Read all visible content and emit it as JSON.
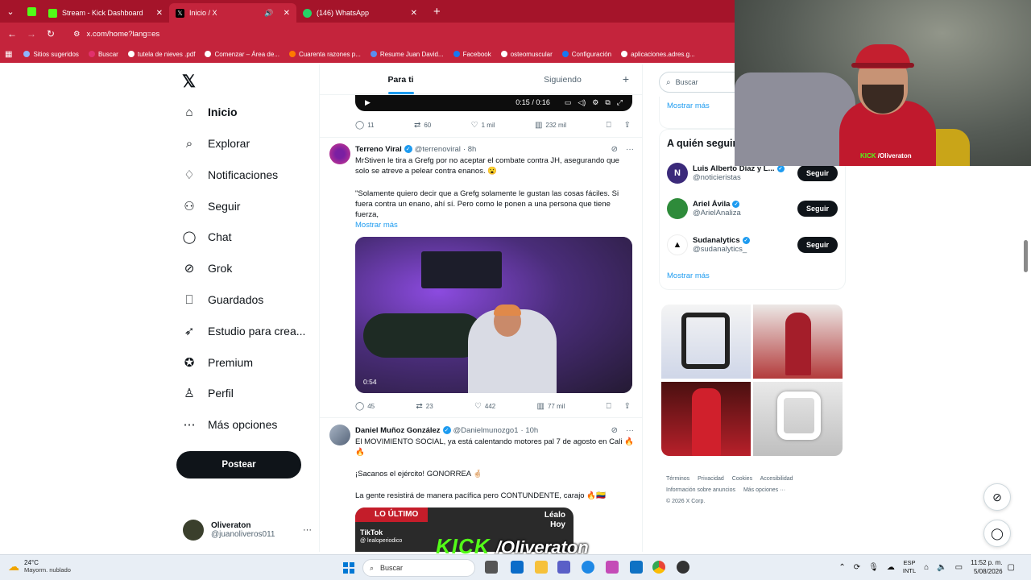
{
  "browser": {
    "tabs": [
      {
        "title": "Stream - Kick Dashboard",
        "color": "#53fc18"
      },
      {
        "title": "Inicio / X",
        "color": "#000000"
      },
      {
        "title": "(146) WhatsApp",
        "color": "#25d366"
      }
    ],
    "url": "x.com/home?lang=es",
    "bookmarks": [
      "Sitios sugeridos",
      "Buscar",
      "tutela de nieves .pdf",
      "Comenzar – Área de...",
      "Cuarenta razones p...",
      "Resume Juan David...",
      "Facebook",
      "osteomuscular",
      "Configuración",
      "aplicaciones.adres.g..."
    ]
  },
  "nav": {
    "items": [
      {
        "label": "Inicio",
        "icon": "home-icon"
      },
      {
        "label": "Explorar",
        "icon": "search-icon"
      },
      {
        "label": "Notificaciones",
        "icon": "bell-icon"
      },
      {
        "label": "Seguir",
        "icon": "follow-icon"
      },
      {
        "label": "Chat",
        "icon": "chat-icon"
      },
      {
        "label": "Grok",
        "icon": "grok-icon"
      },
      {
        "label": "Guardados",
        "icon": "bookmark-icon"
      },
      {
        "label": "Estudio para crea...",
        "icon": "rocket-icon"
      },
      {
        "label": "Premium",
        "icon": "premium-icon"
      },
      {
        "label": "Perfil",
        "icon": "person-icon"
      },
      {
        "label": "Más opciones",
        "icon": "more-icon"
      }
    ],
    "post_label": "Postear",
    "user": {
      "name": "Oliveraton",
      "handle": "@juanoliveros011"
    }
  },
  "timeline": {
    "tabs": [
      "Para ti",
      "Siguiendo"
    ],
    "video_time": "0:15 / 0:16",
    "tweet0_actions": {
      "replies": "11",
      "reposts": "60",
      "likes": "1 mil",
      "views": "232 mil"
    },
    "tweet1": {
      "name": "Terreno Viral",
      "handle": "@terrenoviral",
      "time": "· 8h",
      "text1": "MrStiven le tira a Grefg por no aceptar el combate contra JH, asegurando que solo se atreve a pelear contra enanos. 😮",
      "text2": "\"Solamente quiero decir que a Grefg solamente le gustan las cosas fáciles. Si fuera contra un enano, ahí sí. Pero como le ponen a una persona que tiene fuerza,",
      "more": "Mostrar más",
      "duration": "0:54",
      "actions": {
        "replies": "45",
        "reposts": "23",
        "likes": "442",
        "views": "77 mil"
      }
    },
    "tweet2": {
      "name": "Daniel Muñoz González",
      "handle": "@Danielmunozgo1",
      "time": "· 10h",
      "text1": "El MOVIMIENTO SOCIAL, ya está calentando motores pal 7 de agosto en Cali 🔥🔥",
      "text2": "¡Sacanos el ejército! GONORREA 🤞🏻",
      "text3": "La gente resistirá de manera pacífica pero CONTUNDENTE, carajo 🔥🇨🇴",
      "media_banner": "LO ÚLTIMO",
      "media_tiktok": "TikTok",
      "media_tiktok_handle": "@ lealoperiodico",
      "media_lealo": "Léalo\nHoy"
    }
  },
  "right": {
    "search_placeholder": "Buscar",
    "show_more": "Mostrar más",
    "who_to_follow": "A quién seguir",
    "suggestions": [
      {
        "name": "Luis Alberto Díaz y L...",
        "handle": "@noticieristas",
        "initial": "N",
        "color": "#3b2a7a",
        "btn": "Seguir"
      },
      {
        "name": "Ariel Ávila",
        "handle": "@ArielAnaliza",
        "initial": "",
        "color": "#2e8b3a",
        "btn": "Seguir"
      },
      {
        "name": "Sudanalytics",
        "handle": "@sudanalytics_",
        "initial": "▲",
        "color": "#ffffff",
        "btn": "Seguir"
      }
    ],
    "footer": [
      "Términos",
      "Privacidad",
      "Cookies",
      "Accesibilidad",
      "Información sobre anuncios",
      "Más opciones ···",
      "© 2026 X Corp."
    ]
  },
  "overlay": {
    "kick": "KICK",
    "channel": "/Oliveraton"
  },
  "taskbar": {
    "temp": "24°C",
    "weather": "Mayorm. nublado",
    "search": "Buscar",
    "lang1": "ESP",
    "lang2": "INTL",
    "time": "11:52 p. m.",
    "date": "5/08/2026"
  }
}
